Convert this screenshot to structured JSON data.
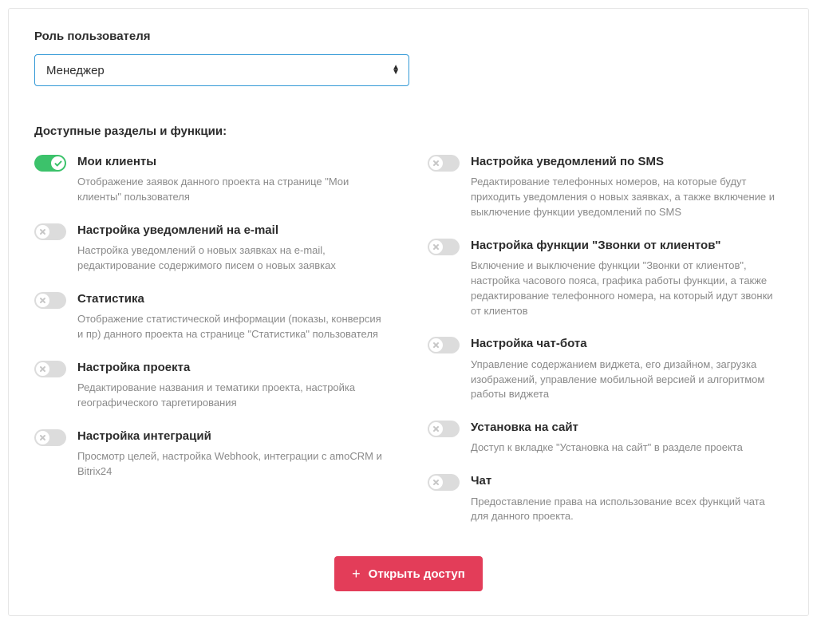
{
  "role": {
    "label": "Роль пользователя",
    "selected": "Менеджер"
  },
  "section_label": "Доступные разделы и функции:",
  "features": {
    "left": [
      {
        "on": true,
        "title": "Мои клиенты",
        "desc": "Отображение заявок данного проекта на странице \"Мои клиенты\" пользователя"
      },
      {
        "on": false,
        "title": "Настройка уведомлений на e-mail",
        "desc": "Настройка уведомлений о новых заявках на e-mail, редактирование содержимого писем о новых заявках"
      },
      {
        "on": false,
        "title": "Статистика",
        "desc": "Отображение статистической информации (показы, конверсия и пр) данного проекта на странице \"Статистика\" пользователя"
      },
      {
        "on": false,
        "title": "Настройка проекта",
        "desc": "Редактирование названия и тематики проекта, настройка географического таргетирования"
      },
      {
        "on": false,
        "title": "Настройка интеграций",
        "desc": "Просмотр целей, настройка Webhook, интеграции с amoCRM и Bitrix24"
      }
    ],
    "right": [
      {
        "on": false,
        "title": "Настройка уведомлений по SMS",
        "desc": "Редактирование телефонных номеров, на которые будут приходить уведомления о новых заявках, а также включение и выключение функции уведомлений по SMS"
      },
      {
        "on": false,
        "title": "Настройка функции \"Звонки от клиентов\"",
        "desc": "Включение и выключение функции \"Звонки от клиентов\", настройка часового пояса, графика работы функции, а также редактирование телефонного номера, на который идут звонки от клиентов"
      },
      {
        "on": false,
        "title": "Настройка чат-бота",
        "desc": "Управление содержанием виджета, его дизайном, загрузка изображений, управление мобильной версией и алгоритмом работы виджета"
      },
      {
        "on": false,
        "title": "Установка на сайт",
        "desc": "Доступ к вкладке \"Установка на сайт\" в разделе проекта"
      },
      {
        "on": false,
        "title": "Чат",
        "desc": "Предоставление права на использование всех функций чата для данного проекта."
      }
    ]
  },
  "submit_label": "Открыть доступ"
}
